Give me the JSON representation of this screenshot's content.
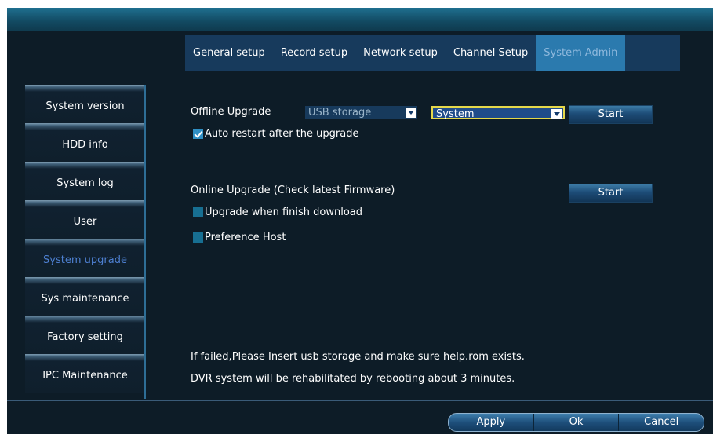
{
  "tabs": [
    {
      "label": "General setup"
    },
    {
      "label": "Record setup"
    },
    {
      "label": "Network setup"
    },
    {
      "label": "Channel Setup"
    },
    {
      "label": "System Admin",
      "active": true
    }
  ],
  "sidebar": {
    "items": [
      {
        "label": "System version"
      },
      {
        "label": "HDD info"
      },
      {
        "label": "System log"
      },
      {
        "label": "User"
      },
      {
        "label": "System upgrade",
        "active": true
      },
      {
        "label": "Sys maintenance"
      },
      {
        "label": "Factory setting"
      },
      {
        "label": "IPC Maintenance"
      }
    ]
  },
  "offline": {
    "label": "Offline Upgrade",
    "source_value": "USB storage",
    "target_value": "System",
    "start_label": "Start",
    "auto_restart_label": "Auto restart after the upgrade",
    "auto_restart_checked": true
  },
  "online": {
    "label": "Online Upgrade (Check latest Firmware)",
    "start_label": "Start",
    "upgrade_when_done_label": "Upgrade when finish download",
    "upgrade_when_done_checked": false,
    "preference_host_label": "Preference Host",
    "preference_host_checked": false
  },
  "notes": {
    "line1": "If failed,Please Insert usb storage and make sure help.rom exists.",
    "line2": "DVR system will be rehabilitated by rebooting about 3 minutes."
  },
  "footer": {
    "apply_label": "Apply",
    "ok_label": "Ok",
    "cancel_label": "Cancel"
  },
  "colors": {
    "background": "#0d1c27",
    "tab_bar": "#173a5c",
    "tab_active": "#2b7aae",
    "sidebar_active_text": "#4d7fd0",
    "select_focus_border": "#e5d84a"
  }
}
